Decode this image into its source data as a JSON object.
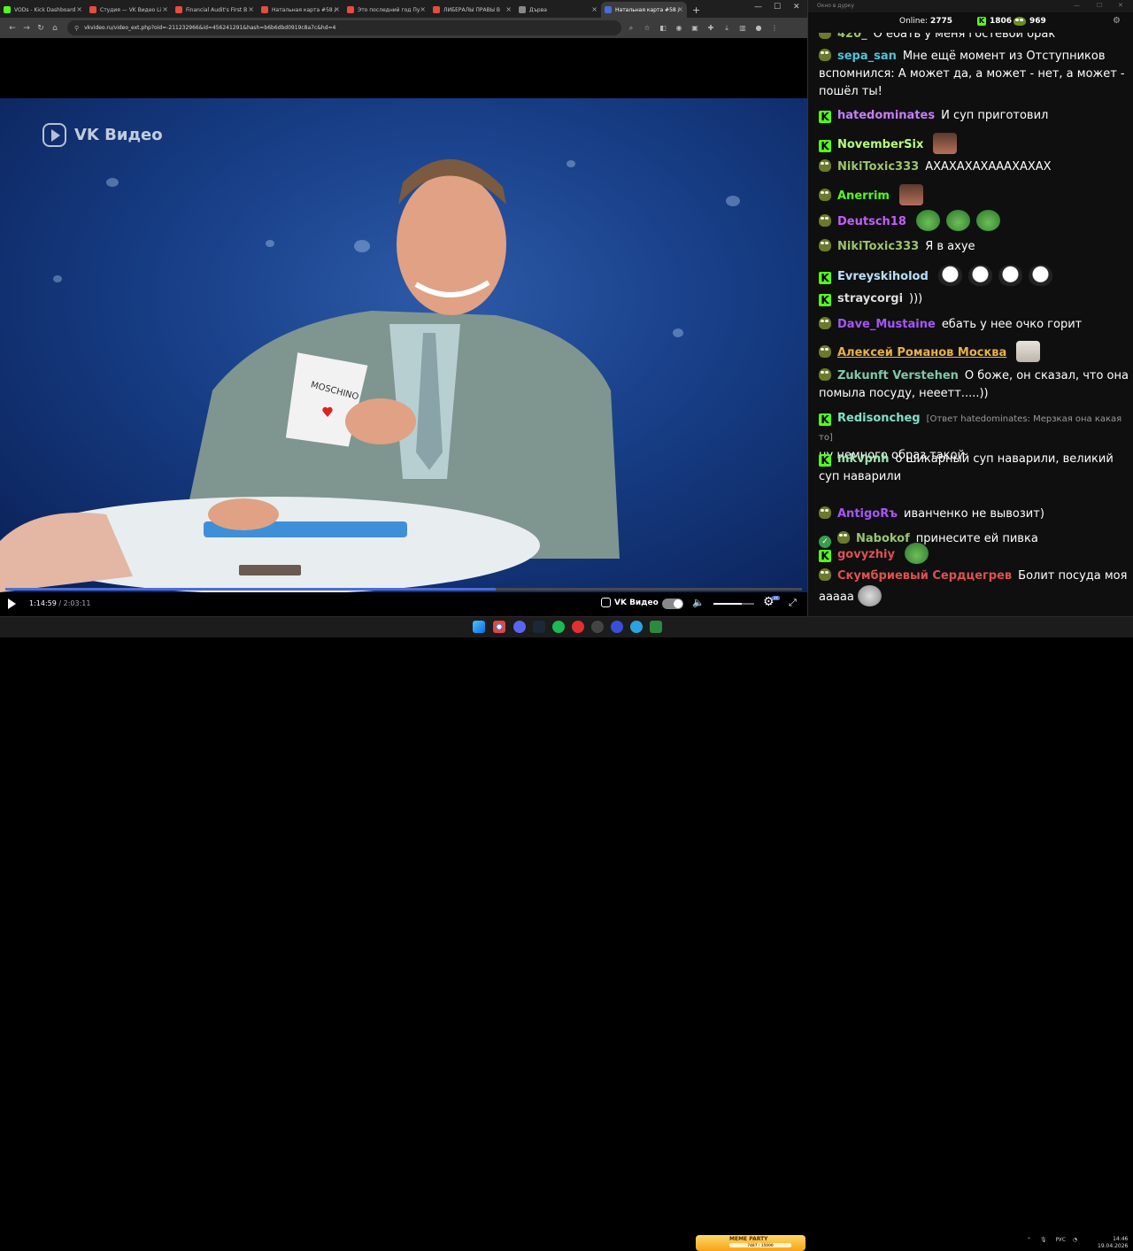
{
  "browser": {
    "tabs": [
      {
        "title": "VODs - Kick Dashboard",
        "color": "#53fc18"
      },
      {
        "title": "Студия — VK Видео Li",
        "color": "#e74c3c"
      },
      {
        "title": "Financial Audit's First B",
        "color": "#e74c3c"
      },
      {
        "title": "Натальная карта #58 /",
        "color": "#e74c3c"
      },
      {
        "title": "Это последний год Пу",
        "color": "#e74c3c"
      },
      {
        "title": "ЛИБЕРАЛЫ ПРАВЫ В",
        "color": "#e74c3c"
      },
      {
        "title": "Дърва",
        "color": "#888888"
      },
      {
        "title": "Натальная карта #58 /",
        "color": "#4b6cd8"
      }
    ],
    "active_tab": 7,
    "url": "vkvideo.ru/video_ext.php?oid=-211232966&id=456241291&hash=b6b6dbd0919c8a7c&hd=4"
  },
  "player": {
    "watermark": "VK Видео",
    "current_time": "1:14:59",
    "separator": "/",
    "total_time": "2:03:11",
    "progress_fraction": 0.615,
    "volume_fraction": 0.7,
    "brand": "VK Видео",
    "hd_badge": "4K"
  },
  "chat": {
    "window_title": "Окно в дурку",
    "online_label": "Online:",
    "online_count": "2775",
    "kick_count": "1806",
    "other_count": "969",
    "accent": "#53fc18",
    "messages": [
      {
        "badges": [
          "p"
        ],
        "user": "420_",
        "color": "#9bc46b",
        "text": "О ебать у меня гостевой брак",
        "emotes": []
      },
      {
        "badges": [
          "p"
        ],
        "user": "sepa_san",
        "color": "#4fc3d9",
        "text": "Мне ещё момент из Отступников вспомнился: А может да, а может - нет, а может - пошёл ты!",
        "emotes": []
      },
      {
        "badges": [
          "k"
        ],
        "user": "hatedominates",
        "color": "#c77dff",
        "text": "И суп приготовил",
        "emotes": []
      },
      {
        "badges": [
          "k"
        ],
        "user": "NovemberSix",
        "color": "#b6ff7a",
        "text": "",
        "emotes": [
          "photo"
        ]
      },
      {
        "badges": [
          "p"
        ],
        "user": "NikiToxic333",
        "color": "#9bc46b",
        "text": "АХАХАХАХАААХАХАХ",
        "emotes": []
      },
      {
        "badges": [
          "p"
        ],
        "user": "Anerrim",
        "color": "#53fc18",
        "text": "",
        "emotes": [
          "photo"
        ]
      },
      {
        "badges": [
          "p"
        ],
        "user": "Deutsch18",
        "color": "#c45cff",
        "text": "",
        "emotes": [
          "frog",
          "frog",
          "frog"
        ]
      },
      {
        "badges": [
          "p"
        ],
        "user": "NikiToxic333",
        "color": "#9bc46b",
        "text": "Я в ахуе",
        "emotes": []
      },
      {
        "badges": [
          "k"
        ],
        "user": "Evreyskiholod",
        "color": "#b8e0ff",
        "text": "",
        "emotes": [
          "drop",
          "drop",
          "drop",
          "drop"
        ]
      },
      {
        "badges": [
          "k"
        ],
        "user": "straycorgi",
        "color": "#dddddd",
        "text": ")))",
        "emotes": []
      },
      {
        "badges": [
          "p"
        ],
        "user": "Dave_Mustaine",
        "color": "#a855f7",
        "text": "ебать у нее очко горит",
        "emotes": []
      },
      {
        "badges": [
          "p"
        ],
        "user": "Алексей Романов Москва",
        "color": "#e8b04a",
        "text": "",
        "emotes": [
          "cat"
        ]
      },
      {
        "badges": [
          "p"
        ],
        "user": "Zukunft Verstehen",
        "color": "#7fc8a9",
        "text": "О боже, он сказал, что она помыла посуду, нееетт.....))",
        "emotes": []
      },
      {
        "badges": [
          "k"
        ],
        "user": "Redisoncheg",
        "color": "#7fe0c8",
        "reply": "[Ответ hatedominates: Мерзкая она какая то]",
        "text": "ну немного образ такой",
        "emotes": []
      },
      {
        "badges": [
          "k"
        ],
        "user": "mkvpnh",
        "color": "#9be5b0",
        "text": "о шикарный суп наварили, великий суп наварили",
        "emotes": []
      },
      {
        "badges": [
          "p"
        ],
        "user": "AntigoRъ",
        "color": "#a855f7",
        "text": "иванченко не вывозит)",
        "emotes": []
      },
      {
        "badges": [
          "v",
          "p"
        ],
        "user": "Nabokof",
        "color": "#9bc46b",
        "text": "принесите ей пивка",
        "emotes": []
      },
      {
        "badges": [
          "k"
        ],
        "user": "govyzhiy",
        "color": "#e05050",
        "text": "",
        "emotes": [
          "frog"
        ]
      },
      {
        "badges": [
          "p"
        ],
        "user": "Скумбриевый Сердцегрев",
        "color": "#e05050",
        "text": "Болит посуда моя ааааа",
        "emotes": [
          "face"
        ]
      }
    ]
  },
  "taskbar": {
    "meme_label": "MEME PARTY",
    "meme_progress": "7487 / 15000",
    "lang": "РУС",
    "time": "14:46",
    "date": "19.04.2026"
  }
}
